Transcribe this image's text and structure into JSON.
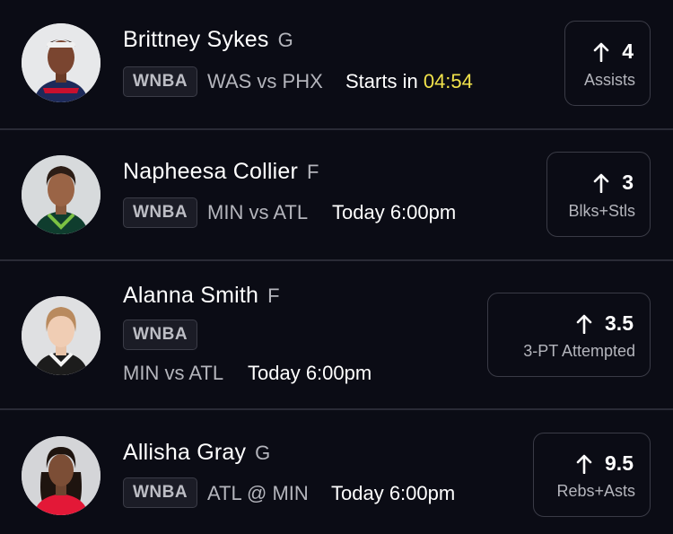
{
  "colors": {
    "background": "#0b0c15",
    "divider": "#2a2b36",
    "countdown": "#f2e34b",
    "secondary_text": "#b4b5bc"
  },
  "players": [
    {
      "name": "Brittney Sykes",
      "position": "G",
      "league": "WNBA",
      "matchup": "WAS vs PHX",
      "time_prefix": "Starts in",
      "countdown": "04:54",
      "direction_icon": "arrow-up-icon",
      "line_value": "4",
      "stat": "Assists"
    },
    {
      "name": "Napheesa Collier",
      "position": "F",
      "league": "WNBA",
      "matchup": "MIN vs ATL",
      "time": "Today 6:00pm",
      "direction_icon": "arrow-up-icon",
      "line_value": "3",
      "stat": "Blks+Stls"
    },
    {
      "name": "Alanna Smith",
      "position": "F",
      "league": "WNBA",
      "matchup": "MIN vs ATL",
      "time": "Today 6:00pm",
      "direction_icon": "arrow-up-icon",
      "line_value": "3.5",
      "stat": "3-PT Attempted"
    },
    {
      "name": "Allisha Gray",
      "position": "G",
      "league": "WNBA",
      "matchup": "ATL @ MIN",
      "time": "Today 6:00pm",
      "direction_icon": "arrow-up-icon",
      "line_value": "9.5",
      "stat": "Rebs+Asts"
    }
  ]
}
